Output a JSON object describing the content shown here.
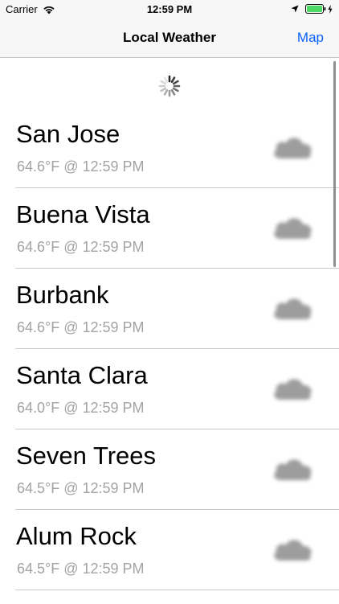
{
  "status_bar": {
    "carrier": "Carrier",
    "time": "12:59 PM",
    "icons": [
      "wifi-icon",
      "location-icon",
      "battery-icon",
      "charging-icon"
    ]
  },
  "nav": {
    "title": "Local Weather",
    "right_button": "Map"
  },
  "colors": {
    "accent": "#0a60fe",
    "secondary_text": "#a3a3a3",
    "separator": "#c8c7cc",
    "battery_fill": "#4cd964"
  },
  "loading_indicator": "spinner-icon",
  "stations": [
    {
      "city": "San Jose",
      "reading": "64.6°F @ 12:59 PM",
      "icon": "cloud-icon"
    },
    {
      "city": "Buena Vista",
      "reading": "64.6°F @ 12:59 PM",
      "icon": "cloud-icon"
    },
    {
      "city": "Burbank",
      "reading": "64.6°F @ 12:59 PM",
      "icon": "cloud-icon"
    },
    {
      "city": "Santa Clara",
      "reading": "64.0°F @ 12:59 PM",
      "icon": "cloud-icon"
    },
    {
      "city": "Seven Trees",
      "reading": "64.5°F @ 12:59 PM",
      "icon": "cloud-icon"
    },
    {
      "city": "Alum Rock",
      "reading": "64.5°F @ 12:59 PM",
      "icon": "cloud-icon"
    }
  ]
}
